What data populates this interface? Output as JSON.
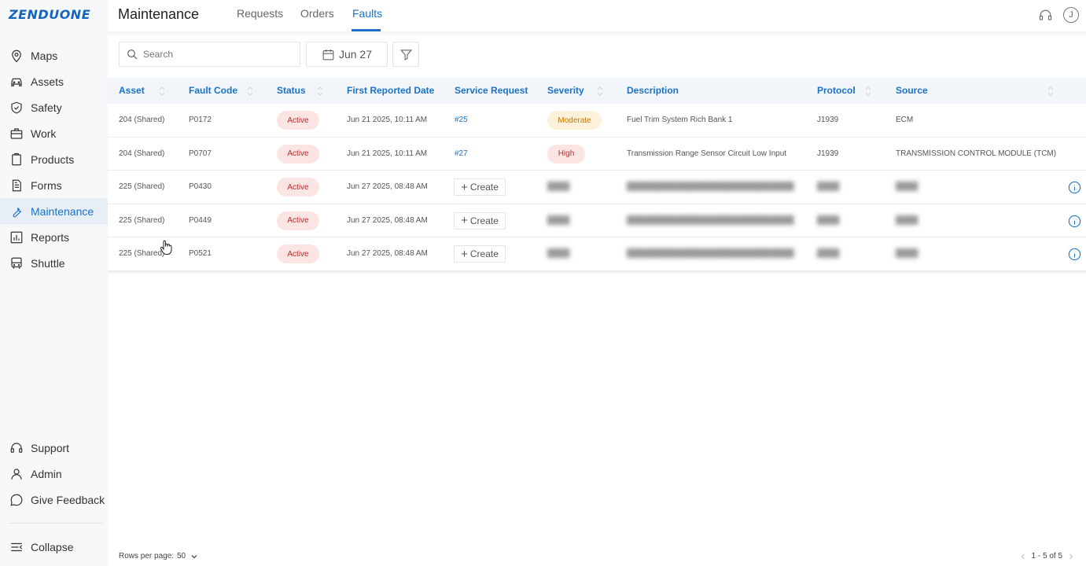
{
  "brand": {
    "logo": "ZENDUONE"
  },
  "sidebar": {
    "items": [
      {
        "label": "Maps",
        "icon": "map-pin-icon"
      },
      {
        "label": "Assets",
        "icon": "car-icon"
      },
      {
        "label": "Safety",
        "icon": "shield-icon"
      },
      {
        "label": "Work",
        "icon": "briefcase-icon"
      },
      {
        "label": "Products",
        "icon": "clipboard-icon"
      },
      {
        "label": "Forms",
        "icon": "document-icon"
      },
      {
        "label": "Maintenance",
        "icon": "wrench-icon",
        "active": true
      },
      {
        "label": "Reports",
        "icon": "chart-icon"
      },
      {
        "label": "Shuttle",
        "icon": "bus-icon"
      }
    ],
    "bottom_items": [
      {
        "label": "Support",
        "icon": "headset-icon"
      },
      {
        "label": "Admin",
        "icon": "user-icon"
      },
      {
        "label": "Give Feedback",
        "icon": "chat-icon"
      }
    ],
    "collapse_label": "Collapse"
  },
  "header": {
    "title": "Maintenance",
    "tabs": [
      {
        "label": "Requests"
      },
      {
        "label": "Orders"
      },
      {
        "label": "Faults",
        "active": true
      }
    ],
    "avatar_letter": "J"
  },
  "toolbar": {
    "search_placeholder": "Search",
    "date_label": "Jun 27"
  },
  "table": {
    "columns": [
      "Asset",
      "Fault Code",
      "Status",
      "First Reported Date",
      "Service Request",
      "Severity",
      "Description",
      "Protocol",
      "Source"
    ],
    "rows": [
      {
        "asset": "204 (Shared)",
        "fault_code": "P0172",
        "status": "Active",
        "date": "Jun 21 2025, 10:11 AM",
        "service_request": "#25",
        "severity": "Moderate",
        "description": "Fuel Trim System Rich Bank 1",
        "protocol": "J1939",
        "source": "ECM"
      },
      {
        "asset": "204 (Shared)",
        "fault_code": "P0707",
        "status": "Active",
        "date": "Jun 21 2025, 10:11 AM",
        "service_request": "#27",
        "severity": "High",
        "description": "Transmission Range Sensor Circuit Low Input",
        "protocol": "J1939",
        "source": "TRANSMISSION CONTROL MODULE (TCM)"
      },
      {
        "asset": "225 (Shared)",
        "fault_code": "P0430",
        "status": "Active",
        "date": "Jun 27 2025, 08:48 AM",
        "service_request": "Create",
        "severity": "",
        "description": "",
        "protocol": "",
        "source": ""
      },
      {
        "asset": "225 (Shared)",
        "fault_code": "P0449",
        "status": "Active",
        "date": "Jun 27 2025, 08:48 AM",
        "service_request": "Create",
        "severity": "",
        "description": "",
        "protocol": "",
        "source": ""
      },
      {
        "asset": "225 (Shared)",
        "fault_code": "P0521",
        "status": "Active",
        "date": "Jun 27 2025, 08:48 AM",
        "service_request": "Create",
        "severity": "",
        "description": "",
        "protocol": "",
        "source": ""
      }
    ]
  },
  "footer": {
    "rows_per_page_label": "Rows per page:",
    "rows_per_page_value": "50",
    "range_label": "1 - 5 of 5"
  }
}
